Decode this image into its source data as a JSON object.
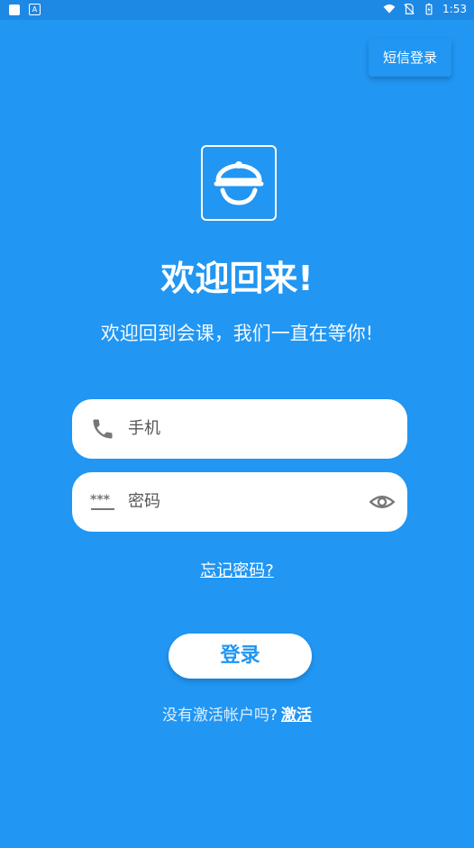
{
  "status_bar": {
    "time": "1:53",
    "icons": [
      "app-icon",
      "keyboard-icon",
      "wifi-icon",
      "no-sim-icon",
      "battery-icon"
    ],
    "keyboard_label": "A"
  },
  "header": {
    "sms_login_label": "短信登录"
  },
  "hero": {
    "title": "欢迎回来!",
    "subtitle": "欢迎回到会课，我们一直在等你!"
  },
  "form": {
    "phone": {
      "placeholder": "手机",
      "value": "",
      "icon": "phone-icon"
    },
    "password": {
      "placeholder": "密码",
      "value": "",
      "icon": "password-mask-icon",
      "toggle_icon": "eye-icon",
      "mask_glyph": "***"
    },
    "forgot_label": "忘记密码?",
    "login_label": "登录"
  },
  "footer": {
    "question": "没有激活帐户吗?",
    "activate_label": "激活"
  },
  "colors": {
    "background": "#2196F3",
    "statusbar": "#1E88E5",
    "primary_text": "#FFFFFF",
    "button_text": "#2196F3"
  }
}
